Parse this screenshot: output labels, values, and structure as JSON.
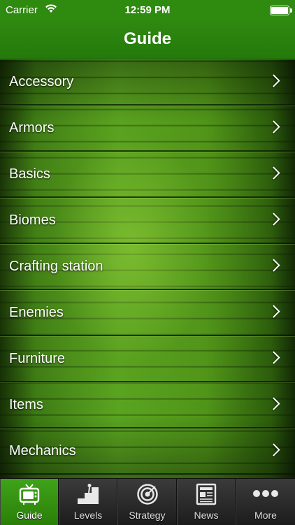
{
  "status": {
    "carrier": "Carrier",
    "time": "12:59 PM"
  },
  "nav": {
    "title": "Guide"
  },
  "list": {
    "items": [
      {
        "label": "Accessory"
      },
      {
        "label": "Armors"
      },
      {
        "label": "Basics"
      },
      {
        "label": "Biomes"
      },
      {
        "label": "Crafting station"
      },
      {
        "label": "Enemies"
      },
      {
        "label": "Furniture"
      },
      {
        "label": "Items"
      },
      {
        "label": "Mechanics"
      }
    ]
  },
  "tabs": [
    {
      "label": "Guide",
      "icon": "tv-icon",
      "active": true
    },
    {
      "label": "Levels",
      "icon": "levels-stairs-icon",
      "active": false
    },
    {
      "label": "Strategy",
      "icon": "target-icon",
      "active": false
    },
    {
      "label": "News",
      "icon": "newspaper-icon",
      "active": false
    },
    {
      "label": "More",
      "icon": "more-dots-icon",
      "active": false
    }
  ],
  "colors": {
    "accent_green": "#2f8a10",
    "tab_active": "#3fa319",
    "tabbar_bg": "#2a2a2a"
  }
}
